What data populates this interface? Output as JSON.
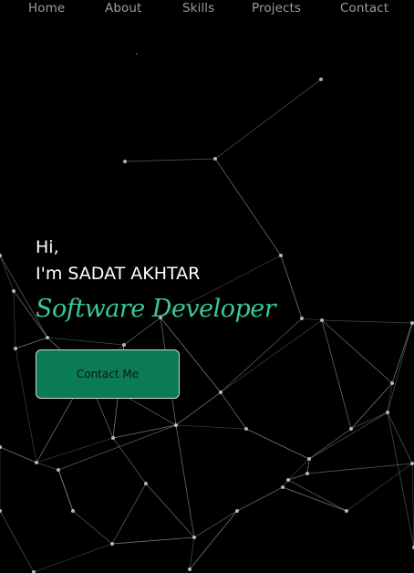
{
  "nav": {
    "items": [
      {
        "label": "Home"
      },
      {
        "label": "About"
      },
      {
        "label": "Skills"
      },
      {
        "label": "Projects"
      },
      {
        "label": "Contact"
      }
    ]
  },
  "hero": {
    "greeting": "Hi,",
    "intro": "I'm SADAT AKHTAR",
    "role": "Software Developer",
    "contact_button_label": "Contact Me"
  },
  "colors": {
    "background": "#000000",
    "accent": "#39c892",
    "button_fill": "#0b7a56",
    "nav_text": "#9c9c9c"
  }
}
